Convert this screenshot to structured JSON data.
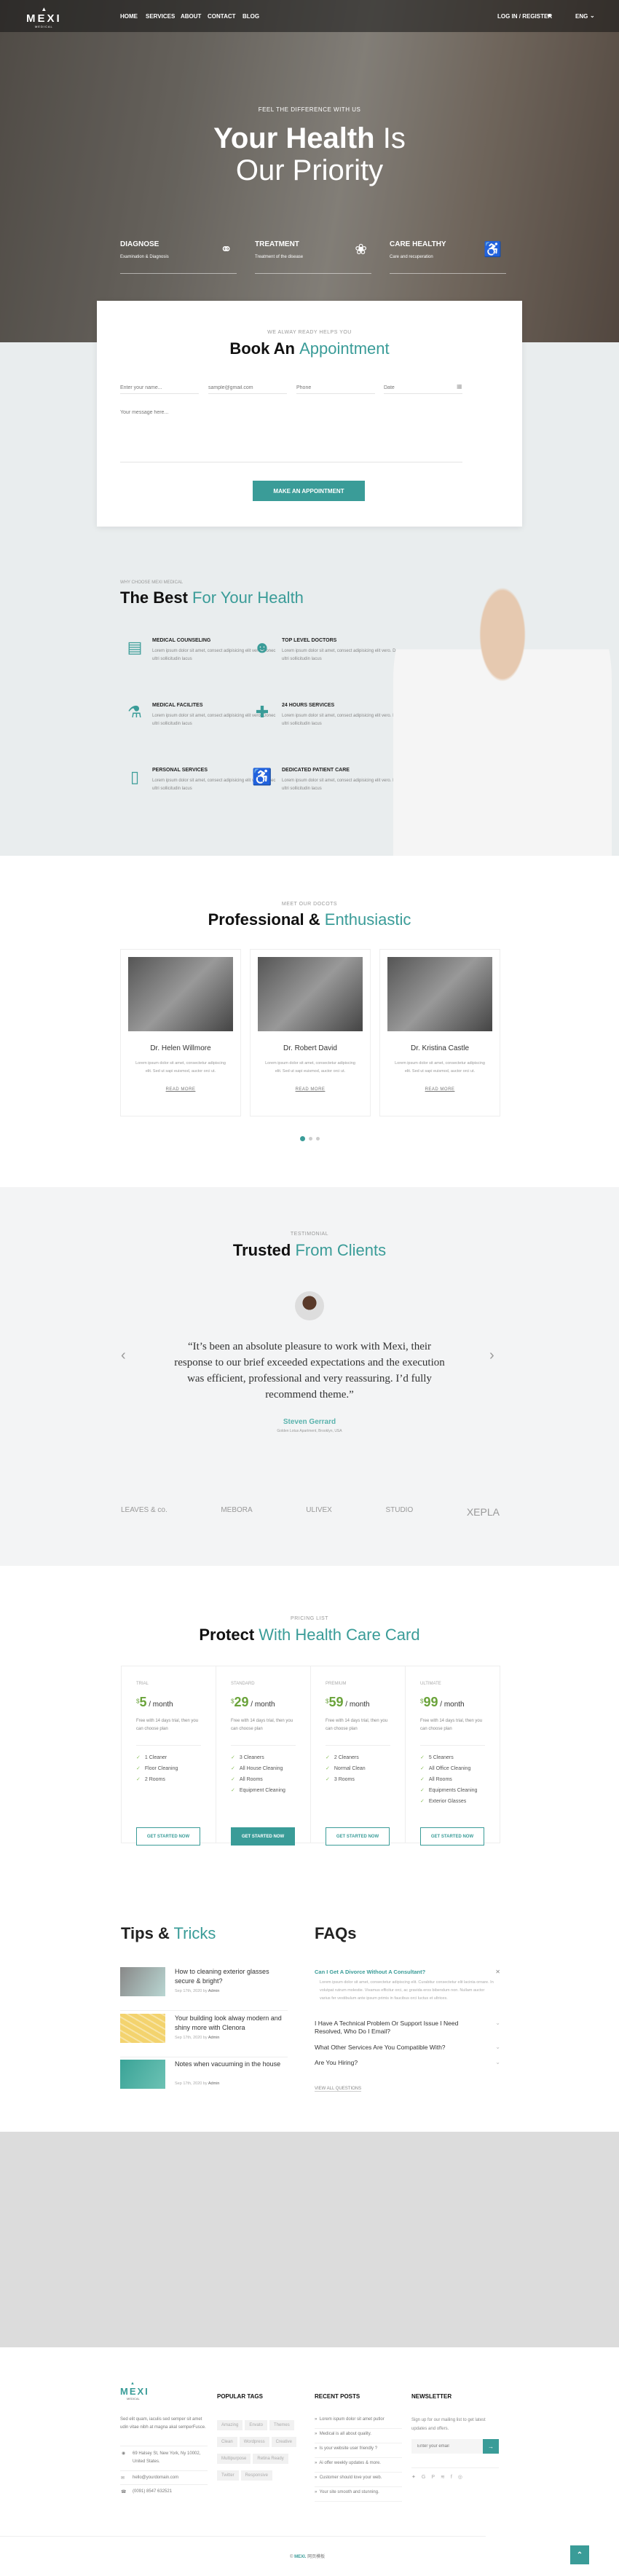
{
  "brand": {
    "name": "MEXI",
    "tagline": "MEDICAL",
    "accent": "#3a9c98"
  },
  "nav": {
    "items": [
      "HOME",
      "SERVICES",
      "ABOUT",
      "CONTACT",
      "BLOG"
    ],
    "login": "LOG IN / REGISTER",
    "lang": "ENG"
  },
  "hero": {
    "subtitle": "FEEL THE DIFFERENCE WITH US",
    "title_bold": "Your Health",
    "title_light": "Is",
    "title_line2": "Our Priority",
    "features": [
      {
        "title": "DIAGNOSE",
        "desc": "Examination & Diagnosis",
        "icon": "stethoscope-icon"
      },
      {
        "title": "TREATMENT",
        "desc": "Treatment of the disease",
        "icon": "brain-icon"
      },
      {
        "title": "CARE HEALTHY",
        "desc": "Care and recuperation",
        "icon": "wheelchair-icon"
      }
    ]
  },
  "appointment": {
    "subtitle": "WE ALWAY READY HELPS YOU",
    "title_bold": "Book An",
    "title_light": "Appointment",
    "name_ph": "Enter your name...",
    "email_ph": "sample@gmail.com",
    "phone_ph": "Phone",
    "date_ph": "Date",
    "message_ph": "Your message here...",
    "button": "MAKE AN APPOINTMENT"
  },
  "best": {
    "subtitle": "WHY CHOOSE MEXI MEDICAL",
    "title_bold": "The Best",
    "title_light": "For Your Health",
    "items": [
      {
        "title": "MEDICAL COUNSELING",
        "desc": "Lorem ipsum dolor sit amet, consect adipisicing elit vero. Donec ultri sollicitudin lacus",
        "icon": "clipboard-icon"
      },
      {
        "title": "TOP LEVEL DOCTORS",
        "desc": "Lorem ipsum dolor sit amet, consect adipisicing elit vero. Donec ultri sollicitudin lacus",
        "icon": "doctor-icon"
      },
      {
        "title": "MEDICAL FACILITES",
        "desc": "Lorem ipsum dolor sit amet, consect adipisicing elit vero. Donec ultri sollicitudin lacus",
        "icon": "microscope-icon"
      },
      {
        "title": "24 HOURS SERVICES",
        "desc": "Lorem ipsum dolor sit amet, consect adipisicing elit vero. Donec ultri sollicitudin lacus",
        "icon": "ambulance-icon"
      },
      {
        "title": "PERSONAL SERVICES",
        "desc": "Lorem ipsum dolor sit amet, consect adipisicing elit vero. Donec ultri sollicitudin lacus",
        "icon": "iv-bag-icon"
      },
      {
        "title": "DEDICATED PATIENT CARE",
        "desc": "Lorem ipsum dolor sit amet, consect adipisicing elit vero. Donec ultri sollicitudin lacus",
        "icon": "wheelchair-icon"
      }
    ]
  },
  "doctors": {
    "subtitle": "MEET OUR DOCOTS",
    "title_bold": "Professional &",
    "title_light": "Enthusiastic",
    "read_more": "READ MORE",
    "items": [
      {
        "name": "Dr. Helen Willmore",
        "desc": "Lorem ipsum dolor sit amet, consectetur adipiscing elit. Sed ut sapi euismod, auctor orci ut."
      },
      {
        "name": "Dr. Robert David",
        "desc": "Lorem ipsum dolor sit amet, consectetur adipiscing elit. Sed ut sapi euismod, auctor orci ut."
      },
      {
        "name": "Dr. Kristina Castle",
        "desc": "Lorem ipsum dolor sit amet, consectetur adipiscing elit. Sed ut sapi euismod, auctor orci ut."
      }
    ],
    "active_slide": 1,
    "slide_count": 3
  },
  "testimonial": {
    "subtitle": "TESTIMONIAL",
    "title_bold": "Trusted",
    "title_light": "From Clients",
    "quote": "“It’s been an absolute pleasure to work with Mexi, their response to our brief exceeded expectations and the execution was efficient, professional and very reassuring. I’d fully recommend theme.”",
    "name": "Steven Gerrard",
    "location": "Golden Lotus Apartment, Brooklyn, USA"
  },
  "partners": [
    "LEAVES & co.",
    "MEBORA",
    "ULIVEX",
    "STUDIO",
    "XEPLA"
  ],
  "pricing": {
    "subtitle": "PRICING LIST",
    "title_bold": "Protect",
    "title_light": "With Health Care Card",
    "per": "/ month",
    "currency": "$",
    "desc": "Free with 14 days trial, then you can choose plan",
    "button": "GET STARTED NOW",
    "plans": [
      {
        "name": "TRIAL",
        "price": "5",
        "features": [
          "1 Cleaner",
          "Floor Cleaning",
          "2 Rooms"
        ]
      },
      {
        "name": "STANDARD",
        "price": "29",
        "features": [
          "3 Cleaners",
          "All House Cleaning",
          "All Rooms",
          "Equipment Cleaning"
        ],
        "highlight": true
      },
      {
        "name": "PREMIUM",
        "price": "59",
        "features": [
          "2 Cleaners",
          "Normal Clean",
          "3 Rooms"
        ]
      },
      {
        "name": "ULTIMATE",
        "price": "99",
        "features": [
          "5 Cleaners",
          "All Office Cleaning",
          "All Rooms",
          "Equipments Cleaning",
          "Exterior Glasses"
        ]
      }
    ]
  },
  "tips": {
    "title_bold": "Tips &",
    "title_light": "Tricks",
    "posts": [
      {
        "title": "How to cleaning exterior glasses secure & bright?",
        "date": "Sep 17th, 2020 by",
        "author": "Admin"
      },
      {
        "title": "Your building look alway modern and shiny more with Clenora",
        "date": "Sep 17th, 2020 by",
        "author": "Admin"
      },
      {
        "title": "Notes when vacuuming in the house",
        "date": "Sep 17th, 2020 by",
        "author": "Admin"
      }
    ]
  },
  "faqs": {
    "title": "FAQs",
    "open_q": "Can I Get A Divorce Without A Consultant?",
    "open_a": "Lorem ipsum dolor sit amet, consectetur adipiscing elit. Curabitur consectetur elit lacinia ornare. In volutpat rutrum molestie. Vivamus efficitur orci, ac gravida eros bibendum non. Nullam auctor varius fer vestibulum ante ipsum primis in faucibus orci luctus et ultrices.",
    "questions": [
      "I Have A Technical Problem Or Support Issue I Need Resolved, Who Do I Email?",
      "What Other Services Are You Compatible With?",
      "Are You Hiring?"
    ],
    "view_all": "VIEW ALL QUESTIONS"
  },
  "footer": {
    "about": "Sed elit quam, iaculis sed semper sit amet udin vitae nibh at magna akal semperFusce.",
    "address": "69 Halsey St, New York, Ny 10002, United States.",
    "email": "hello@yourdomain.com",
    "phone": "(0091) 8547 632521",
    "tags_title": "POPULAR TAGS",
    "tags": [
      "Amazing",
      "Envato",
      "Themes",
      "Clean",
      "Wordpress",
      "Creative",
      "Multipurpose",
      "Retina Ready",
      "Twitter",
      "Responsive"
    ],
    "posts_title": "RECENT POSTS",
    "posts": [
      "Lorem ispum dolor sit amet putlor",
      "Medical is all about quality.",
      "Is your website user friendly ?",
      "Ai offer weekly updates & more.",
      "Customer should love your web.",
      "Your site smooth and stunning."
    ],
    "newsletter_title": "NEWSLETTER",
    "newsletter_text": "Sign up for our mailing list to get latest updates and offers.",
    "email_ph": "Enter your email",
    "copyright_sym": "©",
    "copyright_brand": "MEXI.",
    "copyright_text": "网页模板"
  }
}
